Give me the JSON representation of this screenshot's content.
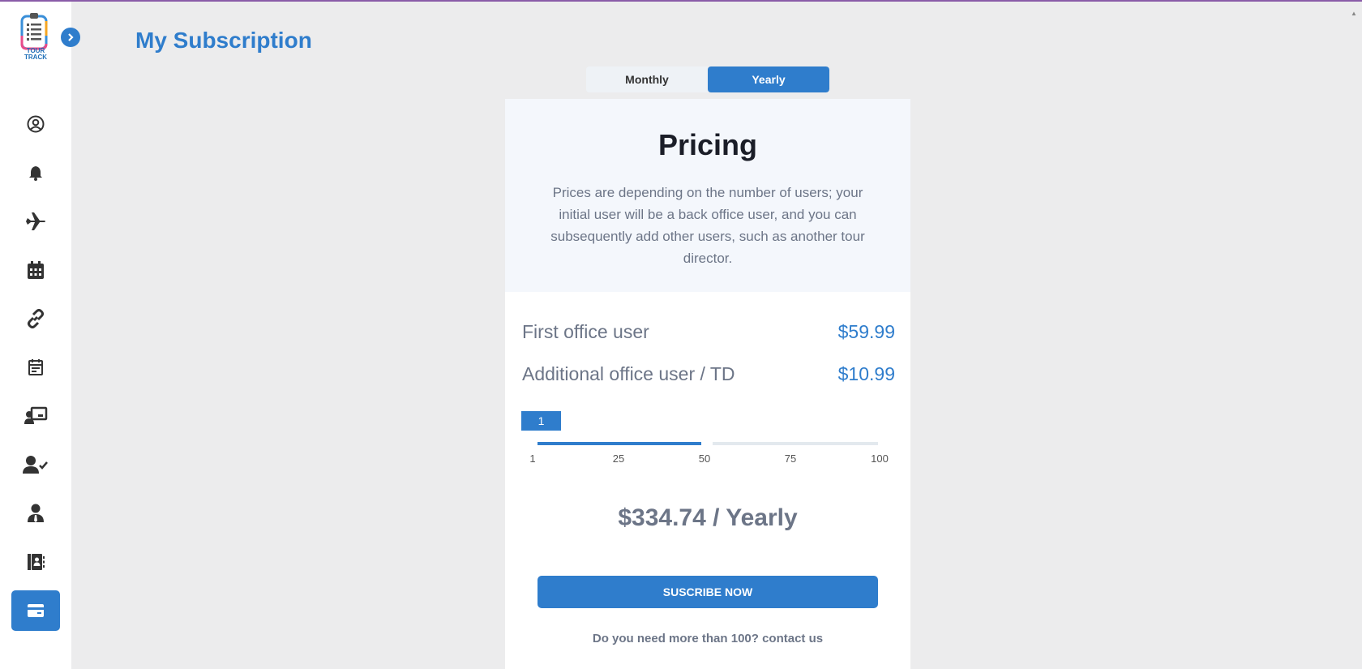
{
  "logo": {
    "text_line1": "TOUR",
    "text_line2": "TRACK"
  },
  "sidebar": {
    "items": [
      {
        "icon": "user-circle-icon"
      },
      {
        "icon": "bell-icon"
      },
      {
        "icon": "airplane-icon"
      },
      {
        "icon": "calendar-icon"
      },
      {
        "icon": "link-icon"
      },
      {
        "icon": "calendar-note-icon"
      },
      {
        "icon": "presentation-icon"
      },
      {
        "icon": "user-check-icon"
      },
      {
        "icon": "user-tie-icon"
      },
      {
        "icon": "address-book-icon"
      },
      {
        "icon": "credit-card-icon",
        "active": true
      }
    ]
  },
  "header": {
    "title": "My Subscription"
  },
  "billing_toggle": {
    "monthly": "Monthly",
    "yearly": "Yearly",
    "selected": "Yearly"
  },
  "pricing": {
    "title": "Pricing",
    "description": "Prices are depending on the number of users; your initial user will be a back office user, and you can subsequently add other users, such as another tour director.",
    "rows": [
      {
        "label": "First office user",
        "amount": "$59.99"
      },
      {
        "label": "Additional office user / TD",
        "amount": "$10.99"
      }
    ],
    "slider": {
      "value": "1",
      "ticks": [
        "1",
        "25",
        "50",
        "75",
        "100"
      ]
    },
    "total": "$334.74 / Yearly",
    "subscribe_label": "SUSCRIBE NOW",
    "contact_text": "Do you need more than 100? contact us"
  },
  "colors": {
    "accent": "#2f7dcc",
    "muted_text": "#6c7587",
    "page_bg": "#ececed"
  }
}
